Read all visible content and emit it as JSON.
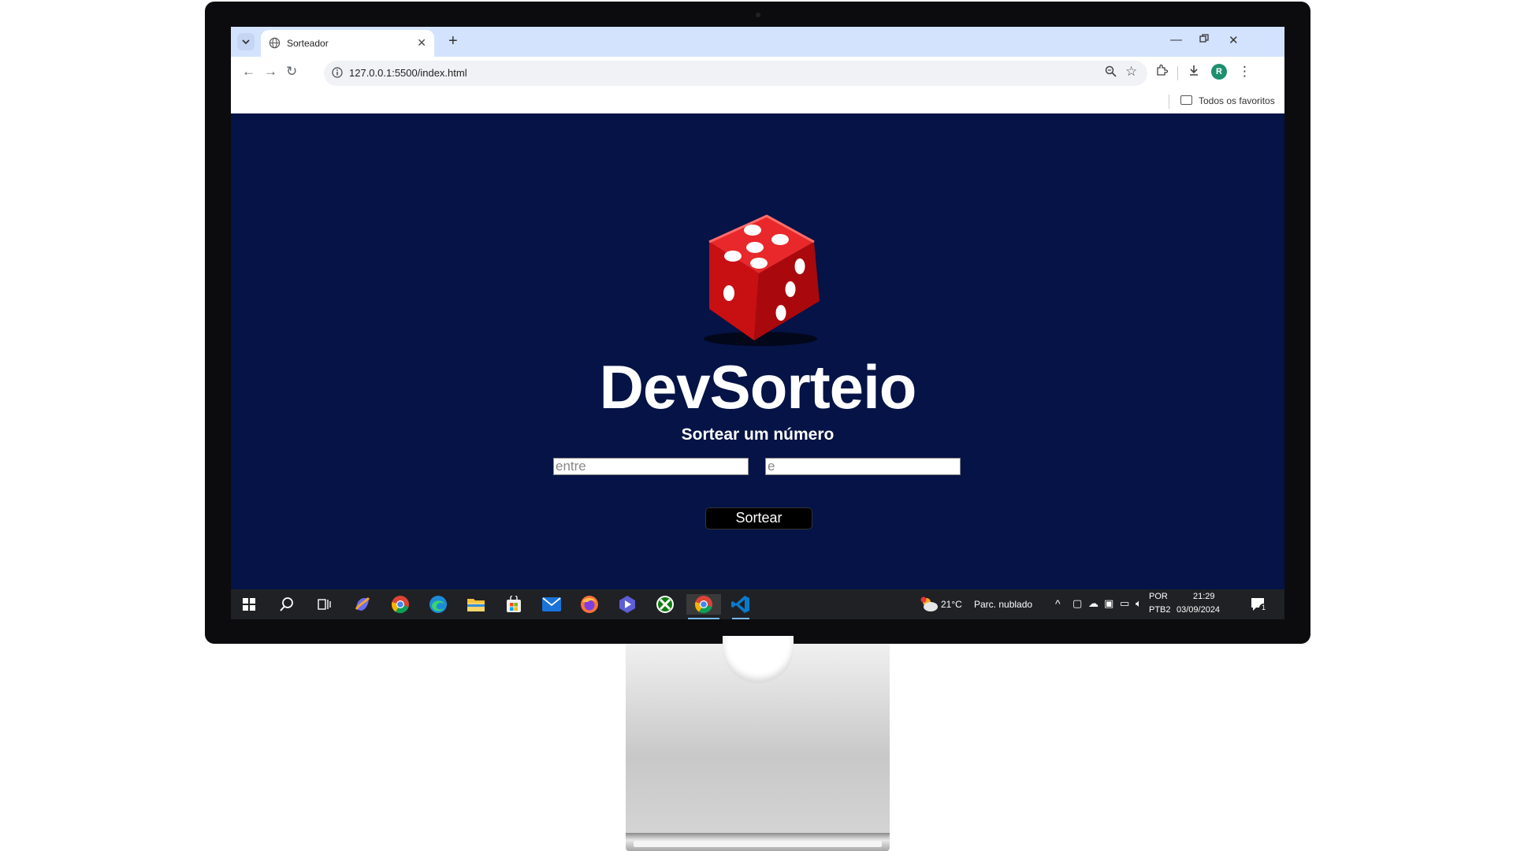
{
  "browser": {
    "tab_title": "Sorteador",
    "tab_close": "✕",
    "new_tab": "+",
    "url": "127.0.0.1:5500/index.html",
    "bookmarks_all": "Todos os favoritos",
    "profile_initial": "R"
  },
  "page": {
    "title": "DevSorteio",
    "subtitle": "Sortear um número",
    "input_min_placeholder": "entre",
    "input_max_placeholder": "e",
    "button_label": "Sortear"
  },
  "taskbar": {
    "weather_temp": "21°C",
    "weather_text": "Parc. nublado",
    "lang": "POR",
    "layout": "PTB2",
    "time": "21:29",
    "date": "03/09/2024",
    "notification_count": "1"
  },
  "colors": {
    "page_bg": "#051346",
    "dice_red": "#d41417",
    "button_bg": "#000000"
  }
}
